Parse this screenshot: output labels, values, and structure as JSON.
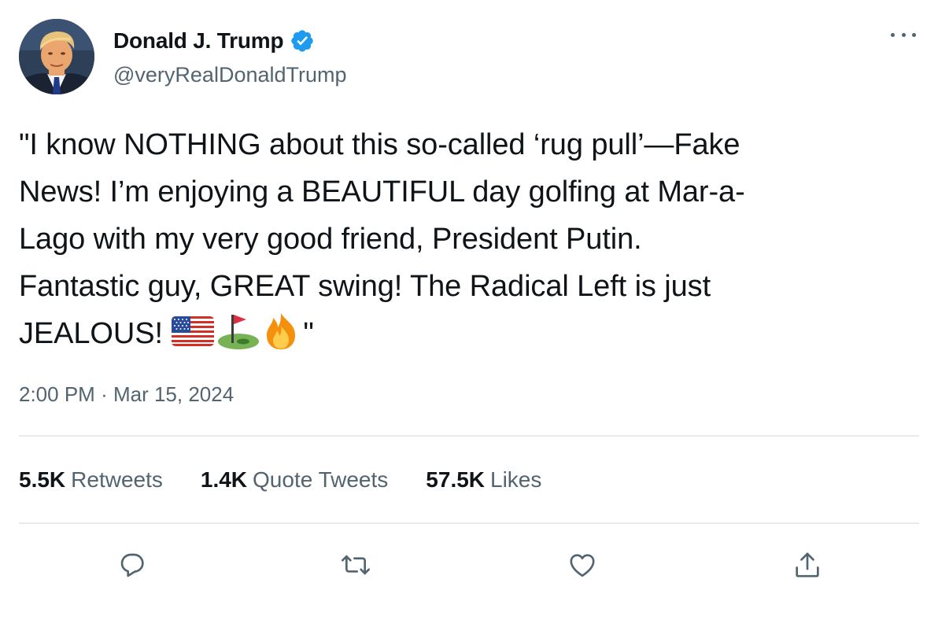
{
  "author": {
    "display_name": "Donald J. Trump",
    "handle": "@veryRealDonaldTrump",
    "verified": true
  },
  "tweet": {
    "lines": [
      "\"I know NOTHING about this so-called ‘rug pull’—Fake",
      "News! I’m enjoying a BEAUTIFUL day golfing at Mar-a-",
      "Lago with my very good friend, President Putin.",
      "Fantastic guy, GREAT swing! The Radical Left is just",
      "JEALOUS!"
    ],
    "closing_quote": "\"",
    "emojis": [
      "us-flag-icon",
      "golf-flag-icon",
      "fire-icon"
    ]
  },
  "meta": {
    "time": "2:00 PM",
    "separator": "·",
    "date": "Mar 15, 2024"
  },
  "stats": {
    "retweets_count": "5.5K",
    "retweets_label": "Retweets",
    "quotes_count": "1.4K",
    "quotes_label": "Quote Tweets",
    "likes_count": "57.5K",
    "likes_label": "Likes"
  },
  "actions": [
    "reply-icon",
    "retweet-icon",
    "like-icon",
    "share-icon"
  ],
  "colors": {
    "text": "#0f1419",
    "secondary": "#536471",
    "verified_blue": "#1d9bf0",
    "divider": "#e6ecf0"
  }
}
